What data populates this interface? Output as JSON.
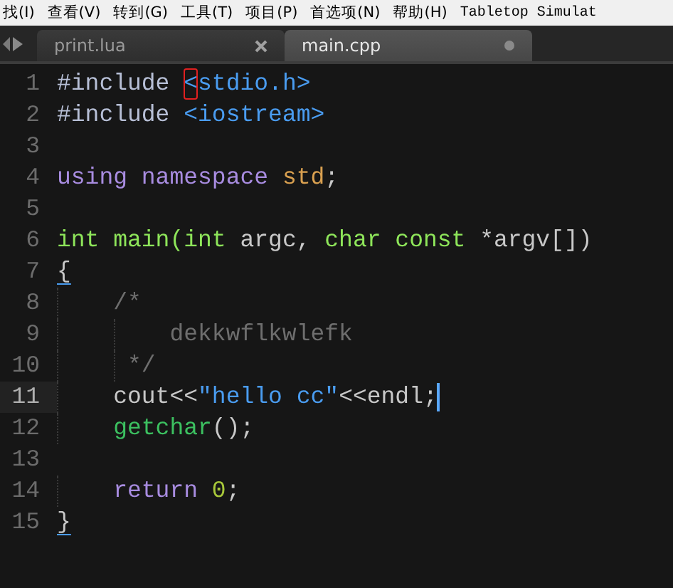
{
  "menu": [
    {
      "label": "找(I)"
    },
    {
      "label": "查看(V)"
    },
    {
      "label": "转到(G)"
    },
    {
      "label": "工具(T)"
    },
    {
      "label": "项目(P)"
    },
    {
      "label": "首选项(N)"
    },
    {
      "label": "帮助(H)"
    },
    {
      "label": "Tabletop Simulat"
    }
  ],
  "tabs": [
    {
      "label": "print.lua",
      "selected": false,
      "modified": false
    },
    {
      "label": "main.cpp",
      "selected": true,
      "modified": true
    }
  ],
  "editor": {
    "lines": [
      {
        "number": "1",
        "current": false,
        "tokens": [
          {
            "text": "#include ",
            "kind": "preproc"
          },
          {
            "text": "<",
            "kind": "header",
            "boxed": true
          },
          {
            "text": "stdio.h>",
            "kind": "header"
          }
        ]
      },
      {
        "number": "2",
        "current": false,
        "tokens": [
          {
            "text": "#include ",
            "kind": "preproc"
          },
          {
            "text": "<iostream>",
            "kind": "header"
          }
        ]
      },
      {
        "number": "3",
        "current": false
      },
      {
        "number": "4",
        "current": false,
        "tokens": [
          {
            "text": "using namespace ",
            "kind": "keyword"
          },
          {
            "text": "std",
            "kind": "name"
          },
          {
            "text": ";",
            "kind": "plain"
          }
        ]
      },
      {
        "number": "5",
        "current": false
      },
      {
        "number": "6",
        "current": false,
        "tokens": [
          {
            "text": "int main(int ",
            "kind": "type"
          },
          {
            "text": "argc, ",
            "kind": "plain"
          },
          {
            "text": "char const ",
            "kind": "type"
          },
          {
            "text": "*argv[])",
            "kind": "plain"
          }
        ]
      },
      {
        "number": "7",
        "current": false,
        "tokens": [
          {
            "text": "{",
            "kind": "plain",
            "matched": true
          }
        ]
      },
      {
        "number": "8",
        "current": false,
        "tokens": [
          {
            "text": "    /*",
            "kind": "comment"
          }
        ]
      },
      {
        "number": "9",
        "current": false,
        "tokens": [
          {
            "text": "        dekkwflkwlefk",
            "kind": "comment"
          }
        ]
      },
      {
        "number": "10",
        "current": false,
        "tokens": [
          {
            "text": "     */",
            "kind": "comment"
          }
        ]
      },
      {
        "number": "11",
        "current": true,
        "tokens": [
          {
            "text": "    cout<<",
            "kind": "plain"
          },
          {
            "text": "\"hello cc\"",
            "kind": "string"
          },
          {
            "text": "<<endl;",
            "kind": "plain"
          }
        ]
      },
      {
        "number": "12",
        "current": false,
        "tokens": [
          {
            "text": "    getchar",
            "kind": "func"
          },
          {
            "text": "();",
            "kind": "plain"
          }
        ]
      },
      {
        "number": "13",
        "current": false
      },
      {
        "number": "14",
        "current": false,
        "tokens": [
          {
            "text": "    return ",
            "kind": "keyword"
          },
          {
            "text": "0",
            "kind": "number"
          },
          {
            "text": ";",
            "kind": "plain"
          }
        ]
      },
      {
        "number": "15",
        "current": false,
        "tokens": [
          {
            "text": "}",
            "kind": "plain",
            "matched": true
          }
        ]
      }
    ]
  }
}
